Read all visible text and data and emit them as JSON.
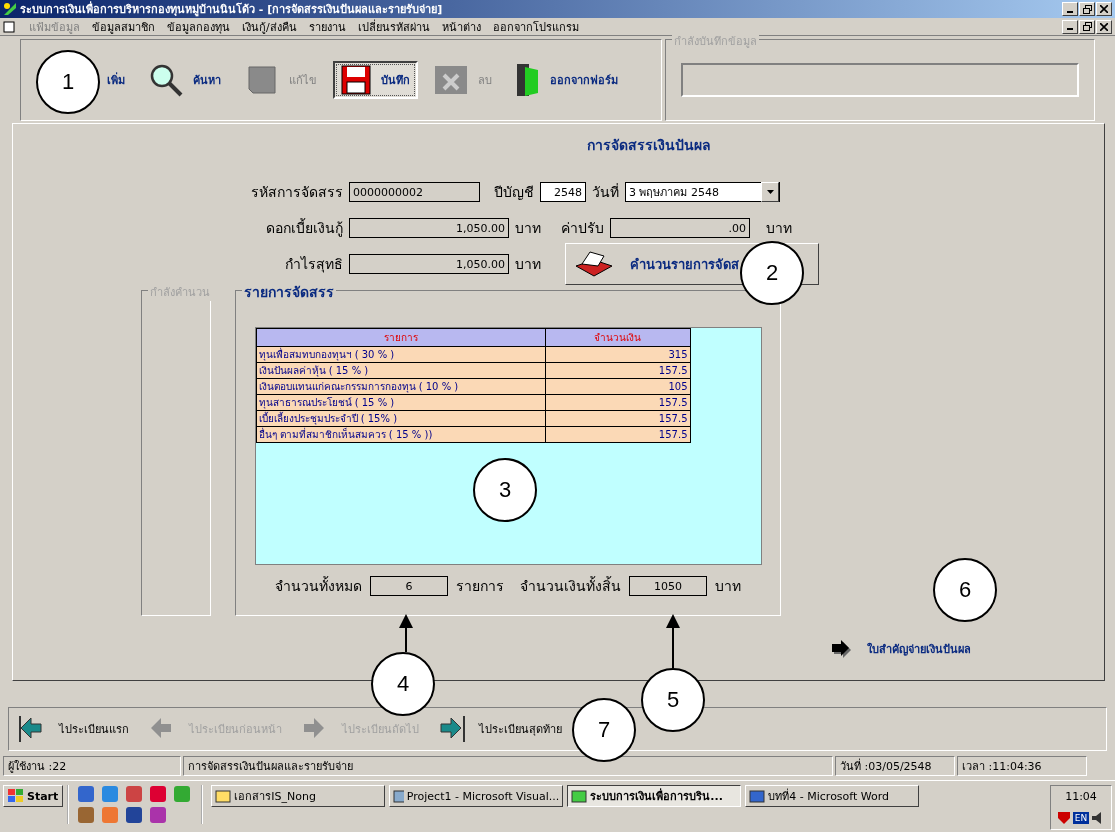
{
  "window": {
    "title": "ระบบการเงินเพื่อการบริหารกองทุนหมู่บ้านนินโด้ว - [การจัดสรรเงินปันผลและรายรับจ่าย]"
  },
  "menu": [
    {
      "label": "แฟ้มข้อมูล",
      "disabled": true
    },
    {
      "label": "ข้อมูลสมาชิก",
      "disabled": false
    },
    {
      "label": "ข้อมูลกองทุน",
      "disabled": false
    },
    {
      "label": "เงินกู้/ส่งคืน",
      "disabled": false
    },
    {
      "label": "รายงาน",
      "disabled": false
    },
    {
      "label": "เปลี่ยนรหัสผ่าน",
      "disabled": false
    },
    {
      "label": "หน้าต่าง",
      "disabled": false
    },
    {
      "label": "ออกจากโปรแกรม",
      "disabled": false
    }
  ],
  "toolbar": [
    {
      "kind": "add",
      "label": "เพิ่ม",
      "disabled": false,
      "pressed": false
    },
    {
      "kind": "search",
      "label": "ค้นหา",
      "disabled": false,
      "pressed": false
    },
    {
      "kind": "edit",
      "label": "แก้ไข",
      "disabled": true,
      "pressed": false
    },
    {
      "kind": "save",
      "label": "บันทึก",
      "disabled": false,
      "pressed": true
    },
    {
      "kind": "delete",
      "label": "ลบ",
      "disabled": true,
      "pressed": false
    },
    {
      "kind": "exit",
      "label": "ออกจากฟอร์ม",
      "disabled": false,
      "pressed": false
    }
  ],
  "saving_group": {
    "label": "กำลังบันทึกข้อมูล"
  },
  "form": {
    "title": "การจัดสรรเงินปันผล",
    "allocation_code": {
      "label": "รหัสการจัดสรร",
      "value": "0000000002"
    },
    "fiscal_year": {
      "label": "ปีบัญชี",
      "value": "2548"
    },
    "date": {
      "label": "วันที่",
      "value": "3  พฤษภาคม  2548"
    },
    "loan_interest": {
      "label": "ดอกเบี้ยเงินกู้",
      "value": "1,050.00",
      "unit": "บาท"
    },
    "fine": {
      "label": "ค่าปรับ",
      "value": ".00",
      "unit": "บาท"
    },
    "net_profit": {
      "label": "กำไรสุทธิ",
      "value": "1,050.00",
      "unit": "บาท"
    },
    "calculate_button": "คำนวนรายการจัดส"
  },
  "calculating_group": {
    "label": "กำลังคำนวน"
  },
  "allocation_group": {
    "label": "รายการจัดสรร",
    "table": {
      "columns": [
        "รายการ",
        "จำนวนเงิน"
      ],
      "rows": [
        [
          "ทุนเพื่อสมทบกองทุนฯ ( 30 % )",
          "315"
        ],
        [
          "เงินปันผลค่าหุ้น ( 15 % )",
          "157.5"
        ],
        [
          "เงินตอบแทนแก่คณะกรรมการกองทุน ( 10 % )",
          "105"
        ],
        [
          "ทุนสาธารณประโยชน์ ( 15 % )",
          "157.5"
        ],
        [
          "เบี้ยเลี้ยงประชุมประจำปี ( 15% )",
          "157.5"
        ],
        [
          "อื่นๆ ตามที่สมาชิกเห็นสมควร ( 15 % ))",
          "157.5"
        ]
      ]
    },
    "total_count": {
      "label": "จำนวนทั้งหมด",
      "value": "6",
      "unit": "รายการ"
    },
    "total_amount": {
      "label": "จำนวนเงินทั้งสิ้น",
      "value": "1050",
      "unit": "บาท"
    }
  },
  "voucher_link": "ใบสำคัญจ่ายเงินปันผล",
  "navigation": [
    {
      "label": "ไประเบียนแรก",
      "kind": "first",
      "disabled": false
    },
    {
      "label": "ไประเบียนก่อนหน้า",
      "kind": "prev",
      "disabled": true
    },
    {
      "label": "ไประเบียนถัดไป",
      "kind": "next",
      "disabled": true
    },
    {
      "label": "ไประเบียนสุดท้าย",
      "kind": "last",
      "disabled": false
    }
  ],
  "status_bar": [
    "ผู้ใช้งาน :22",
    "การจัดสรรเงินปันผลและรายรับจ่าย",
    "วันที่ :03/05/2548",
    "เวลา :11:04:36"
  ],
  "taskbar": {
    "start": "Start",
    "tasks": [
      {
        "label": "เอกสารIS_Nong",
        "selected": false
      },
      {
        "label": "Project1 - Microsoft Visual...",
        "selected": false
      },
      {
        "label": "ระบบการเงินเพื่อการบริน...",
        "selected": true
      },
      {
        "label": "บทที่4 - Microsoft Word",
        "selected": false
      }
    ],
    "clock": "11:04",
    "language": "EN"
  },
  "annotations": [
    {
      "label": "1",
      "pointer": false
    },
    {
      "label": "2",
      "pointer": false
    },
    {
      "label": "3",
      "pointer": false
    },
    {
      "label": "4",
      "pointer": true
    },
    {
      "label": "5",
      "pointer": true
    },
    {
      "label": "6",
      "pointer": false
    },
    {
      "label": "7",
      "pointer": false
    }
  ]
}
